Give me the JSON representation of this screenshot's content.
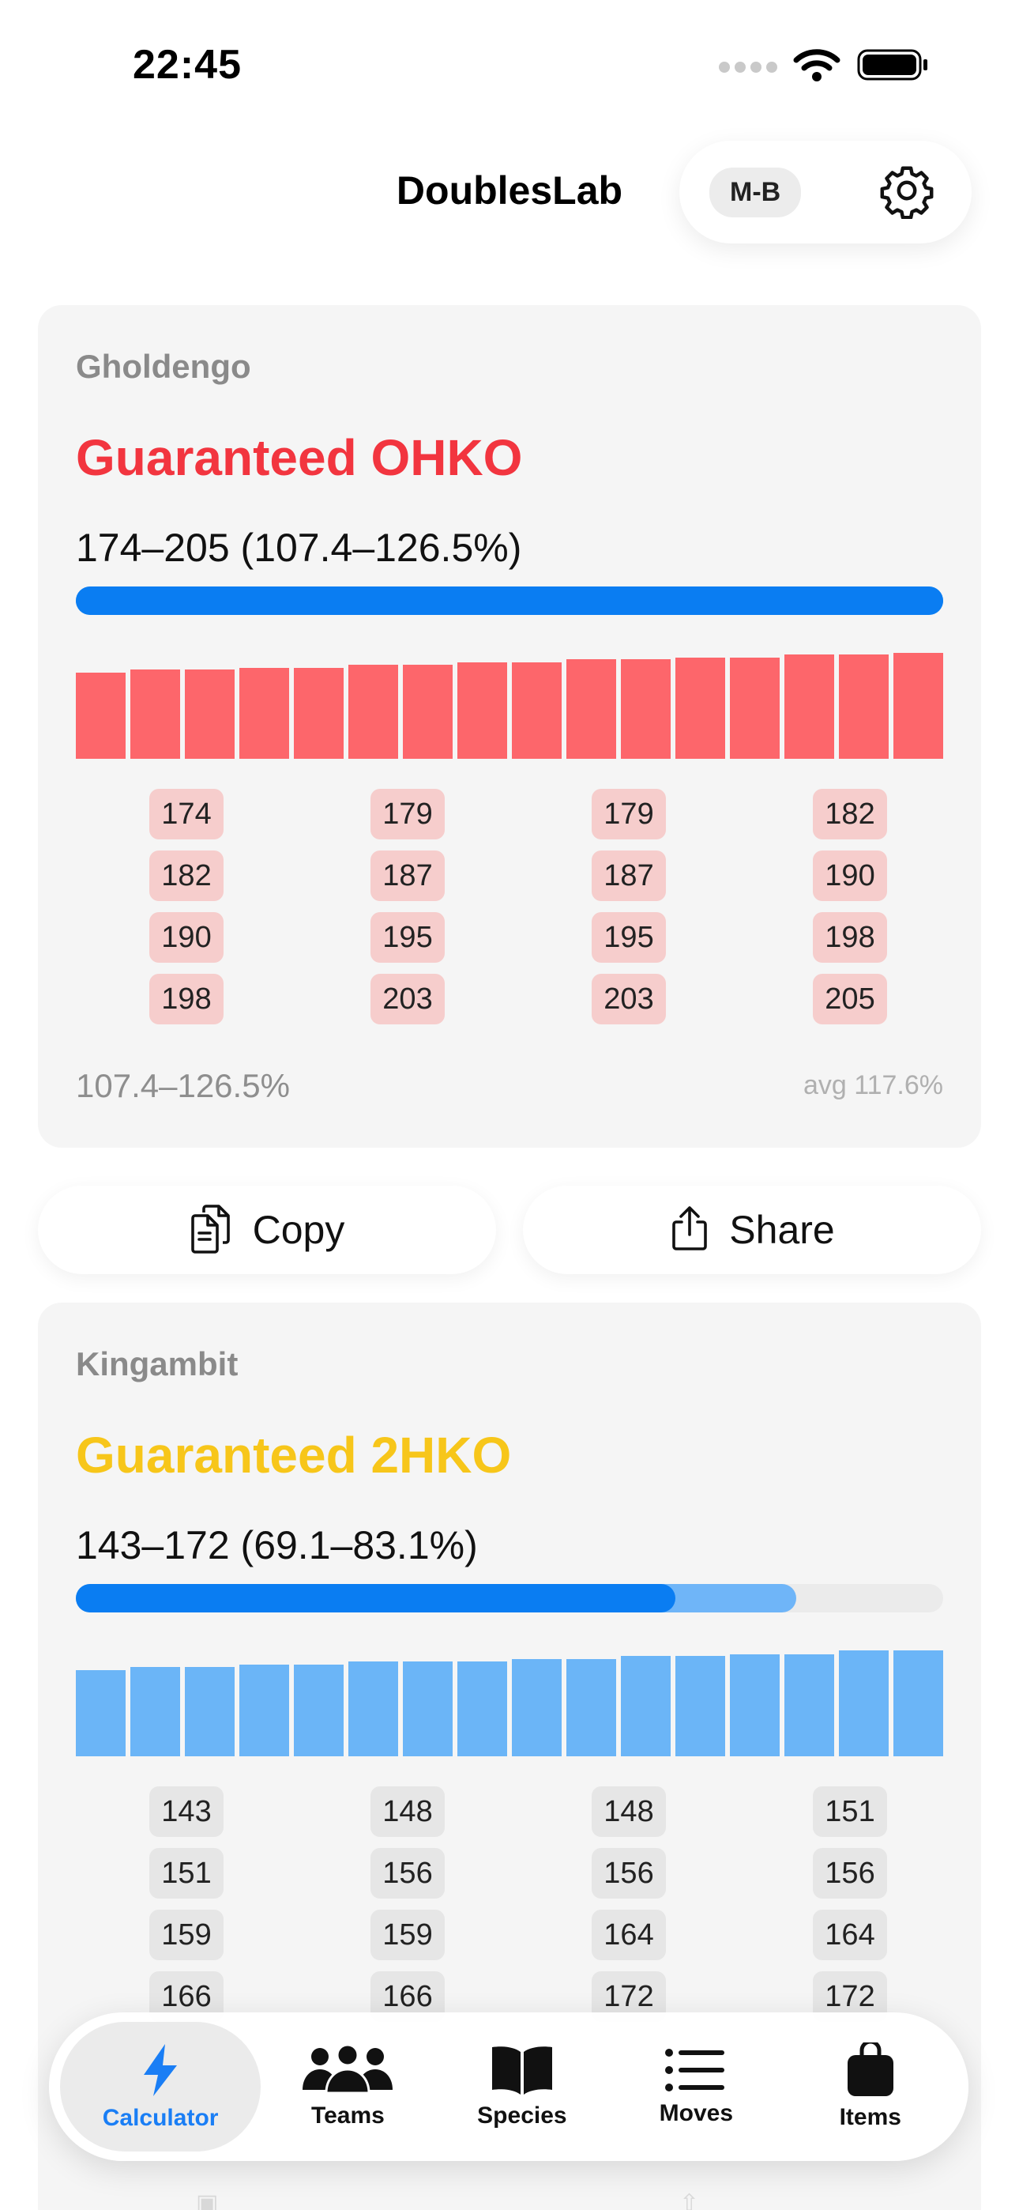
{
  "status_bar": {
    "time": "22:45"
  },
  "nav": {
    "title": "DoublesLab",
    "mode_badge": "M-B"
  },
  "results": [
    {
      "target": "Gholdengo",
      "verdict": "Guaranteed OHKO",
      "damage": "174–205 (107.4–126.5%)",
      "hp_bar_min_fraction": 1.0,
      "hp_bar_max_fraction": 1.0,
      "rolls_row_major": [
        "174",
        "179",
        "179",
        "182",
        "182",
        "187",
        "187",
        "190",
        "190",
        "195",
        "195",
        "198",
        "198",
        "203",
        "203",
        "205"
      ],
      "percent_range": "107.4–126.5%",
      "average": "avg 117.6%"
    },
    {
      "target": "Kingambit",
      "verdict": "Guaranteed 2HKO",
      "damage": "143–172 (69.1–83.1%)",
      "hp_bar_min_fraction": 0.691,
      "hp_bar_max_fraction": 0.831,
      "rolls_row_major": [
        "143",
        "148",
        "148",
        "151",
        "151",
        "156",
        "156",
        "156",
        "159",
        "159",
        "164",
        "164",
        "166",
        "166",
        "172",
        "172"
      ]
    }
  ],
  "actions": {
    "copy_label": "Copy",
    "share_label": "Share"
  },
  "tabs": [
    {
      "label": "Calculator",
      "icon": "bolt-icon",
      "active": true
    },
    {
      "label": "Teams",
      "icon": "people-icon",
      "active": false
    },
    {
      "label": "Species",
      "icon": "book-icon",
      "active": false
    },
    {
      "label": "Moves",
      "icon": "list-icon",
      "active": false
    },
    {
      "label": "Items",
      "icon": "bag-icon",
      "active": false
    }
  ],
  "colors": {
    "ohko_red": "#f2353f",
    "twohko_yellow": "#f7c61a",
    "hp_blue": "#0a7df2",
    "hp_light_blue": "#6fb5f8",
    "roll_bar_red": "#fd666b",
    "roll_bar_blue": "#6bb5f7",
    "accent_tab": "#1a7ef5"
  }
}
